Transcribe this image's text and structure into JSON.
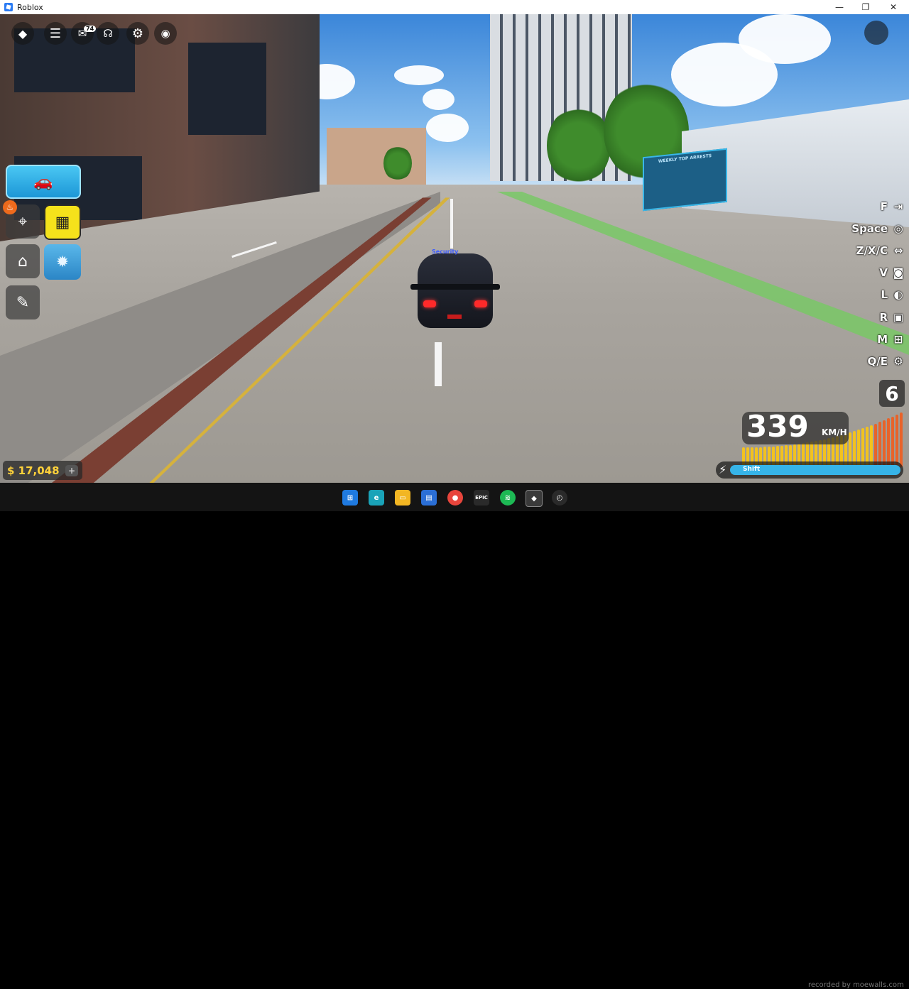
{
  "window": {
    "title": "Roblox",
    "controls": [
      "—",
      "❐",
      "✕"
    ]
  },
  "hud": {
    "chat_count": "74"
  },
  "car_tag": "Security",
  "billboard": {
    "title": "WEEKLY TOP ARRESTS"
  },
  "money": {
    "symbol": "$",
    "amount": "17,048",
    "add_label": "+"
  },
  "controls": [
    {
      "key": "F",
      "icon": "exit-icon",
      "glyph": "⇥"
    },
    {
      "key": "Space",
      "icon": "brake-icon",
      "glyph": "◎"
    },
    {
      "key": "Z/X/C",
      "icon": "indicator-icon",
      "glyph": "⇔"
    },
    {
      "key": "V",
      "icon": "camera-icon",
      "glyph": "◙"
    },
    {
      "key": "L",
      "icon": "headlight-icon",
      "glyph": "◐"
    },
    {
      "key": "R",
      "icon": "radio-icon",
      "glyph": "▣"
    },
    {
      "key": "M",
      "icon": "map-icon",
      "glyph": "⊞"
    },
    {
      "key": "Q/E",
      "icon": "gear-settings-icon",
      "glyph": "⚙"
    }
  ],
  "speedometer": {
    "gear": "6",
    "speed": "339",
    "unit": "KM/H",
    "shift_label": "Shift"
  },
  "taskbar": {
    "apps": [
      "windows-start-icon",
      "edge-icon",
      "file-explorer-icon",
      "store-icon",
      "chrome-icon",
      "epic-games-icon",
      "spotify-icon",
      "roblox-icon",
      "clock-icon"
    ],
    "epic_label": "EPIC",
    "watermark": "recorded by moewalls.com"
  },
  "colors": {
    "accent_blue": "#1c96d6",
    "shop_yellow": "#f5e21b",
    "money_gold": "#ffd23a",
    "rpm_orange": "#e8632a"
  }
}
